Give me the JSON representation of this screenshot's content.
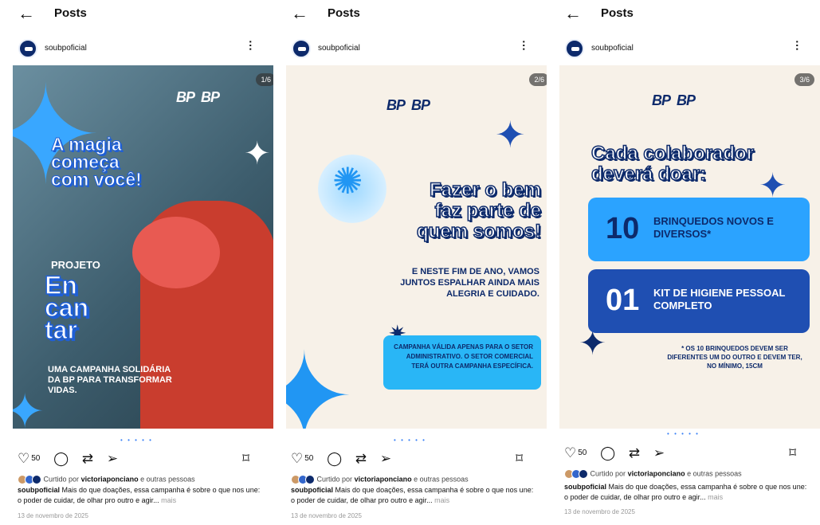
{
  "header": {
    "back_icon": "arrow-left-icon",
    "title": "Posts"
  },
  "account": {
    "username": "soubpoficial"
  },
  "posts": [
    {
      "counter": "1/6",
      "likes": "50",
      "logos": [
        "BP",
        "BP"
      ],
      "headline": [
        "A magia",
        "começa",
        "com você!"
      ],
      "project_label": "PROJETO",
      "project_name": [
        "En",
        "can",
        "tar"
      ],
      "description": "UMA CAMPANHA SOLIDÁRIA DA BP PARA TRANSFORMAR VIDAS."
    },
    {
      "counter": "2/6",
      "likes": "50",
      "logos": [
        "BP",
        "BP"
      ],
      "headline": [
        "Fazer o bem",
        "faz parte de",
        "quem somos!"
      ],
      "body": "E NESTE FIM DE ANO, VAMOS JUNTOS ESPALHAR AINDA MAIS ALEGRIA E CUIDADO.",
      "notice": "CAMPANHA VÁLIDA APENAS PARA O SETOR ADMINISTRATIVO. O SETOR COMERCIAL TERÁ OUTRA CAMPANHA ESPECÍFICA."
    },
    {
      "counter": "3/6",
      "likes": "50",
      "logos": [
        "BP",
        "BP"
      ],
      "headline": [
        "Cada colaborador",
        "deverá doar:"
      ],
      "item1_num": "10",
      "item1_text": "BRINQUEDOS NOVOS E DIVERSOS*",
      "item2_num": "01",
      "item2_text": "KIT DE HIGIENE PESSOAL COMPLETO",
      "note": "* OS 10 BRINQUEDOS DEVEM SER DIFERENTES UM DO OUTRO E DEVEM TER, NO MÍNIMO, 15CM"
    }
  ],
  "engagement": {
    "liked_prefix": "Curtido por",
    "liked_user": "victoriaponciano",
    "liked_suffix": "e outras pessoas",
    "caption_user": "soubpoficial",
    "caption_text": "Mais do que doações, essa campanha é sobre o que nos une: o poder de cuidar, de olhar pro outro e agir...",
    "more": "mais",
    "date": "13 de novembro de 2025"
  },
  "icons": [
    "heart-icon",
    "comment-icon",
    "repost-icon",
    "share-icon",
    "bookmark-icon",
    "more-options-icon"
  ]
}
